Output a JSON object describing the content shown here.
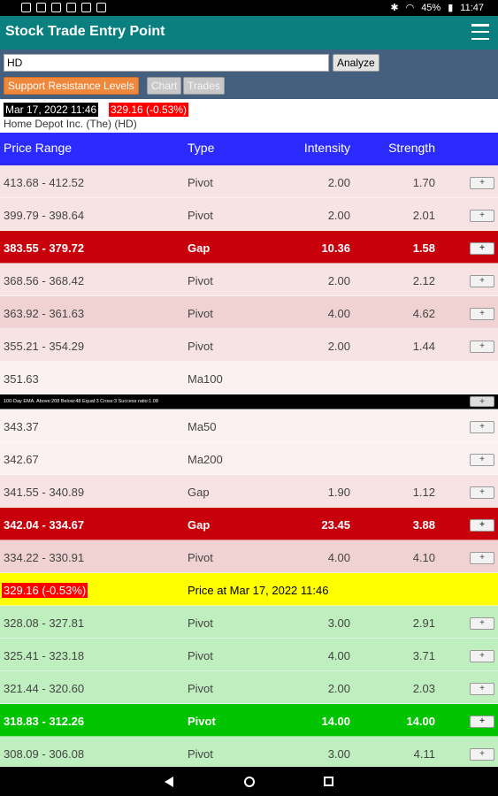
{
  "status_bar": {
    "battery": "45%",
    "time": "11:47"
  },
  "app": {
    "title": "Stock Trade Entry Point"
  },
  "controls": {
    "symbol_value": "HD",
    "analyze_label": "Analyze",
    "tabs": [
      "Support Resistance Levels",
      "Chart",
      "Trades"
    ]
  },
  "quote": {
    "datetime": "Mar 17, 2022 11:46",
    "price_change": "329.16 (-0.53%)",
    "company": "Home Depot Inc. (The) (HD)"
  },
  "table": {
    "headers": [
      "Price Range",
      "Type",
      "Intensity",
      "Strength"
    ],
    "plus_label": "+",
    "rows": [
      {
        "range": "413.68 - 412.52",
        "type": "Pivot",
        "intensity": "2.00",
        "strength": "1.70",
        "style": "res-light",
        "button": true
      },
      {
        "range": "399.79 - 398.64",
        "type": "Pivot",
        "intensity": "2.00",
        "strength": "2.01",
        "style": "res-light",
        "button": true
      },
      {
        "range": "383.55 - 379.72",
        "type": "Gap",
        "intensity": "10.36",
        "strength": "1.58",
        "style": "res-strong",
        "button": true
      },
      {
        "range": "368.56 - 368.42",
        "type": "Pivot",
        "intensity": "2.00",
        "strength": "2.12",
        "style": "res-light",
        "button": true
      },
      {
        "range": "363.92 - 361.63",
        "type": "Pivot",
        "intensity": "4.00",
        "strength": "4.62",
        "style": "res-mid",
        "button": true
      },
      {
        "range": "355.21 - 354.29",
        "type": "Pivot",
        "intensity": "2.00",
        "strength": "1.44",
        "style": "res-light",
        "button": true
      },
      {
        "range": "351.63",
        "type": "Ma100",
        "intensity": "",
        "strength": "",
        "style": "res-faint",
        "button": false
      },
      {
        "note": "100-Day EMA. Above:208 Below:48 Equal:3 Cross:3 Success ratio:1.08",
        "style": "note",
        "button": true
      },
      {
        "range": "343.37",
        "type": "Ma50",
        "intensity": "",
        "strength": "",
        "style": "res-faint",
        "button": true
      },
      {
        "range": "342.67",
        "type": "Ma200",
        "intensity": "",
        "strength": "",
        "style": "res-faint",
        "button": true
      },
      {
        "range": "341.55 - 340.89",
        "type": "Gap",
        "intensity": "1.90",
        "strength": "1.12",
        "style": "res-light",
        "button": true
      },
      {
        "range": "342.04 - 334.67",
        "type": "Gap",
        "intensity": "23.45",
        "strength": "3.88",
        "style": "res-strong",
        "button": true
      },
      {
        "range": "334.22 - 330.91",
        "type": "Pivot",
        "intensity": "4.00",
        "strength": "4.10",
        "style": "res-mid",
        "button": true
      },
      {
        "range": "329.16 (-0.53%)",
        "type": "Price at Mar 17, 2022 11:46",
        "intensity": "",
        "strength": "",
        "style": "current",
        "button": false
      },
      {
        "range": "328.08 - 327.81",
        "type": "Pivot",
        "intensity": "3.00",
        "strength": "2.91",
        "style": "sup-light",
        "button": true
      },
      {
        "range": "325.41 - 323.18",
        "type": "Pivot",
        "intensity": "4.00",
        "strength": "3.71",
        "style": "sup-light",
        "button": true
      },
      {
        "range": "321.44 - 320.60",
        "type": "Pivot",
        "intensity": "2.00",
        "strength": "2.03",
        "style": "sup-light",
        "button": true
      },
      {
        "range": "318.83 - 312.26",
        "type": "Pivot",
        "intensity": "14.00",
        "strength": "14.00",
        "style": "sup-strong",
        "button": true
      },
      {
        "range": "308.09 - 306.08",
        "type": "Pivot",
        "intensity": "3.00",
        "strength": "4.11",
        "style": "sup-light",
        "button": true
      }
    ]
  },
  "colors": {
    "res-light": "#f7e3e3",
    "res-mid": "#f0d2d2",
    "res-strong": "#c8000c",
    "res-faint": "#fcf1f1",
    "current": "#ffff00",
    "sup-light": "#bfeebf",
    "sup-strong": "#00c400",
    "header": "#2b2bff",
    "app_bar": "#0a7f7f"
  }
}
